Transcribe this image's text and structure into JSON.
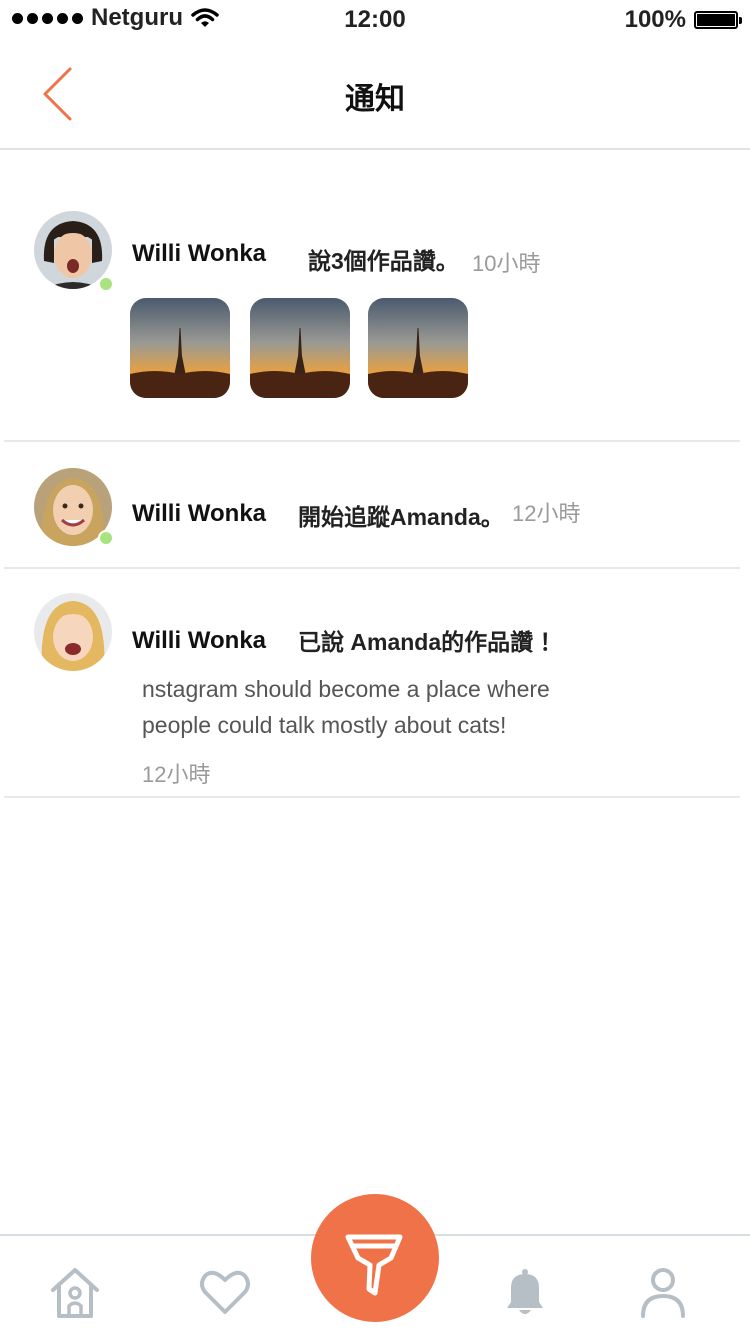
{
  "status_bar": {
    "carrier": "Netguru",
    "time": "12:00",
    "battery": "100%"
  },
  "nav": {
    "title": "通知"
  },
  "notifications": [
    {
      "name": "Willi Wonka",
      "action": "說3個作品讚。",
      "time": "10小時"
    },
    {
      "name": "Willi Wonka",
      "action": "開始追蹤Amanda。",
      "time": "12小時"
    },
    {
      "name": "Willi Wonka",
      "action": "已說 Amanda的作品讚 ！",
      "comment_line1": "nstagram should become a place where",
      "comment_line2": "people could talk mostly about cats!",
      "time": "12小時"
    }
  ],
  "tabs": [
    "home-icon",
    "heart-icon",
    "filter-icon",
    "bell-icon",
    "user-icon"
  ],
  "colors": {
    "accent": "#f07248",
    "online": "#a8e37f",
    "tab_icon": "#b6bec6"
  }
}
